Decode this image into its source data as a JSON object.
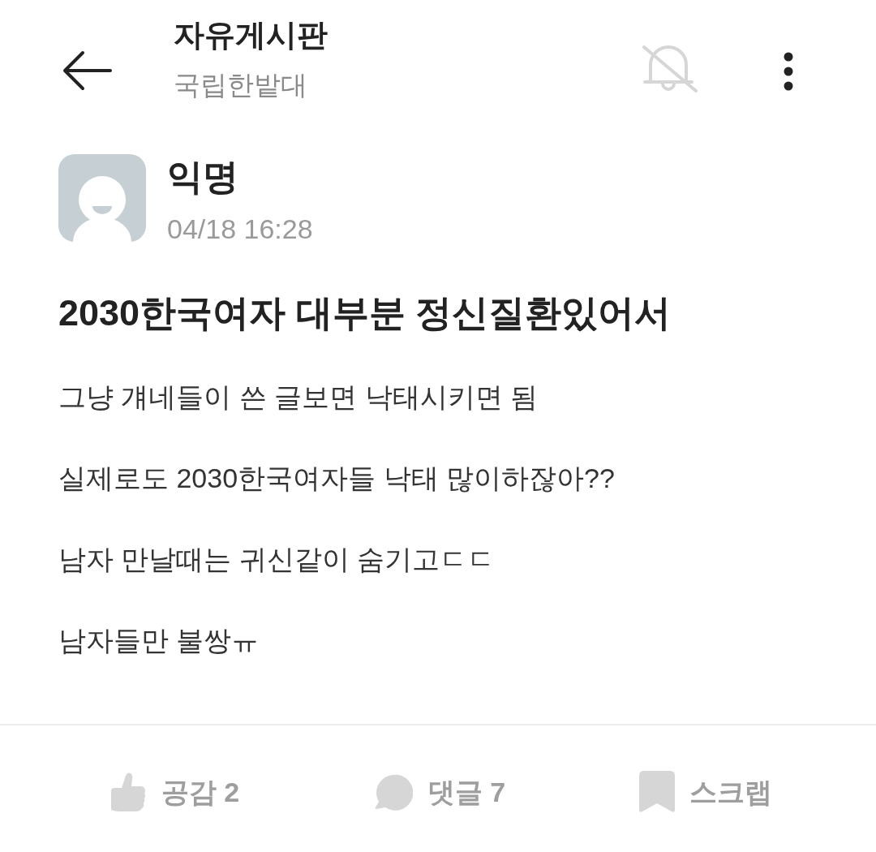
{
  "header": {
    "title": "자유게시판",
    "subtitle": "국립한밭대",
    "notifications_muted": true
  },
  "post": {
    "author": "익명",
    "time": "04/18 16:28",
    "title": "2030한국여자 대부분 정신질환있어서",
    "paragraphs": [
      "그냥 걔네들이 쓴 글보면 낙태시키면 됨",
      "실제로도 2030한국여자들 낙태 많이하잖아??",
      "남자 만날때는 귀신같이 숨기고ㄷㄷ",
      "남자들만 불쌍ㅠ"
    ]
  },
  "actions": [
    {
      "kind": "like",
      "label": "공감 2"
    },
    {
      "kind": "comment",
      "label": "댓글 7"
    },
    {
      "kind": "scrap",
      "label": "스크랩"
    }
  ]
}
